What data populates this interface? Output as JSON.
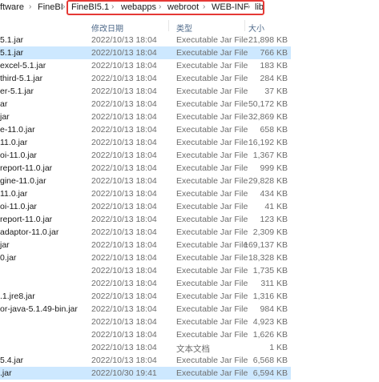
{
  "breadcrumb": {
    "items": [
      "ftware",
      "FineBI",
      "FineBI5.1",
      "webapps",
      "webroot",
      "WEB-INF",
      "lib"
    ],
    "separator": "›"
  },
  "columns": {
    "date": "修改日期",
    "type": "类型",
    "size": "大小"
  },
  "files": [
    {
      "name": "5.1.jar",
      "date": "2022/10/13 18:04",
      "type": "Executable Jar File",
      "size": "21,898 KB"
    },
    {
      "name": "5.1.jar",
      "date": "2022/10/13 18:04",
      "type": "Executable Jar File",
      "size": "766 KB"
    },
    {
      "name": "excel-5.1.jar",
      "date": "2022/10/13 18:04",
      "type": "Executable Jar File",
      "size": "183 KB"
    },
    {
      "name": "third-5.1.jar",
      "date": "2022/10/13 18:04",
      "type": "Executable Jar File",
      "size": "284 KB"
    },
    {
      "name": "er-5.1.jar",
      "date": "2022/10/13 18:04",
      "type": "Executable Jar File",
      "size": "37 KB"
    },
    {
      "name": "ar",
      "date": "2022/10/13 18:04",
      "type": "Executable Jar File",
      "size": "50,172 KB"
    },
    {
      "name": "jar",
      "date": "2022/10/13 18:04",
      "type": "Executable Jar File",
      "size": "32,869 KB"
    },
    {
      "name": "e-11.0.jar",
      "date": "2022/10/13 18:04",
      "type": "Executable Jar File",
      "size": "658 KB"
    },
    {
      "name": "11.0.jar",
      "date": "2022/10/13 18:04",
      "type": "Executable Jar File",
      "size": "16,192 KB"
    },
    {
      "name": "oi-11.0.jar",
      "date": "2022/10/13 18:04",
      "type": "Executable Jar File",
      "size": "1,367 KB"
    },
    {
      "name": "report-11.0.jar",
      "date": "2022/10/13 18:04",
      "type": "Executable Jar File",
      "size": "999 KB"
    },
    {
      "name": "gine-11.0.jar",
      "date": "2022/10/13 18:04",
      "type": "Executable Jar File",
      "size": "29,828 KB"
    },
    {
      "name": "11.0.jar",
      "date": "2022/10/13 18:04",
      "type": "Executable Jar File",
      "size": "434 KB"
    },
    {
      "name": "oi-11.0.jar",
      "date": "2022/10/13 18:04",
      "type": "Executable Jar File",
      "size": "41 KB"
    },
    {
      "name": "report-11.0.jar",
      "date": "2022/10/13 18:04",
      "type": "Executable Jar File",
      "size": "123 KB"
    },
    {
      "name": "adaptor-11.0.jar",
      "date": "2022/10/13 18:04",
      "type": "Executable Jar File",
      "size": "2,309 KB"
    },
    {
      "name": "jar",
      "date": "2022/10/13 18:04",
      "type": "Executable Jar File",
      "size": "169,137 KB"
    },
    {
      "name": "0.jar",
      "date": "2022/10/13 18:04",
      "type": "Executable Jar File",
      "size": "18,328 KB"
    },
    {
      "name": "",
      "date": "2022/10/13 18:04",
      "type": "Executable Jar File",
      "size": "1,735 KB"
    },
    {
      "name": "",
      "date": "2022/10/13 18:04",
      "type": "Executable Jar File",
      "size": "311 KB"
    },
    {
      "name": ".1.jre8.jar",
      "date": "2022/10/13 18:04",
      "type": "Executable Jar File",
      "size": "1,316 KB"
    },
    {
      "name": "or-java-5.1.49-bin.jar",
      "date": "2022/10/13 18:04",
      "type": "Executable Jar File",
      "size": "984 KB"
    },
    {
      "name": "",
      "date": "2022/10/13 18:04",
      "type": "Executable Jar File",
      "size": "4,923 KB"
    },
    {
      "name": "",
      "date": "2022/10/13 18:04",
      "type": "Executable Jar File",
      "size": "1,626 KB"
    },
    {
      "name": "",
      "date": "2022/10/13 18:04",
      "type": "文本文档",
      "size": "1 KB"
    },
    {
      "name": "5.4.jar",
      "date": "2022/10/13 18:04",
      "type": "Executable Jar File",
      "size": "6,568 KB"
    },
    {
      "name": ".jar",
      "date": "2022/10/30 19:41",
      "type": "Executable Jar File",
      "size": "6,594 KB"
    }
  ],
  "selected_rows": [
    1,
    26
  ],
  "colors": {
    "highlight_border": "#e53935",
    "selection": "#cde8ff"
  }
}
